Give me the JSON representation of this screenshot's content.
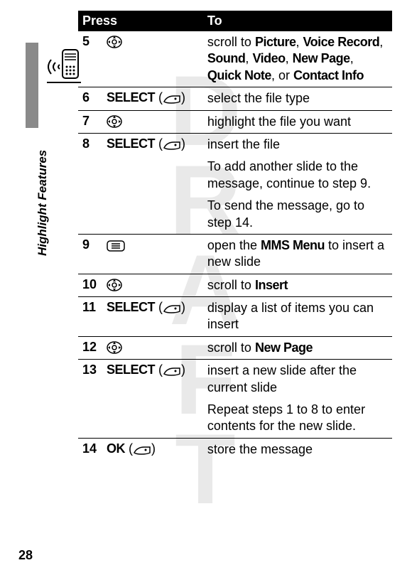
{
  "watermark": "DRAFT",
  "section_label": "Highlight Features",
  "page_number": "28",
  "table": {
    "header_press": "Press",
    "header_to": "To",
    "row5": {
      "num": "5",
      "to_pre": "scroll to ",
      "items": [
        "Picture",
        "Voice Record",
        "Sound",
        "Video",
        "New Page",
        "Quick Note",
        "Contact Info"
      ],
      "to_or": ", or "
    },
    "row6": {
      "num": "6",
      "press": "SELECT",
      "to": "select the file type"
    },
    "row7": {
      "num": "7",
      "to": "highlight the file you want"
    },
    "row8": {
      "num": "8",
      "press": "SELECT",
      "to": "insert the file",
      "p2": "To add another slide to the message, continue to step 9.",
      "p3": "To send the message, go to step 14."
    },
    "row9": {
      "num": "9",
      "to_pre": "open the ",
      "menu": "MMS Menu",
      "to_post": " to insert a new slide"
    },
    "row10": {
      "num": "10",
      "to_pre": "scroll to ",
      "menu": "Insert"
    },
    "row11": {
      "num": "11",
      "press": "SELECT",
      "to": "display a list of items you can insert"
    },
    "row12": {
      "num": "12",
      "to_pre": "scroll to ",
      "menu": "New Page"
    },
    "row13": {
      "num": "13",
      "press": "SELECT",
      "to": "insert a new slide after the current slide",
      "p2": "Repeat steps 1 to 8 to enter contents for the new slide."
    },
    "row14": {
      "num": "14",
      "press": "OK",
      "to": "store the message"
    }
  }
}
